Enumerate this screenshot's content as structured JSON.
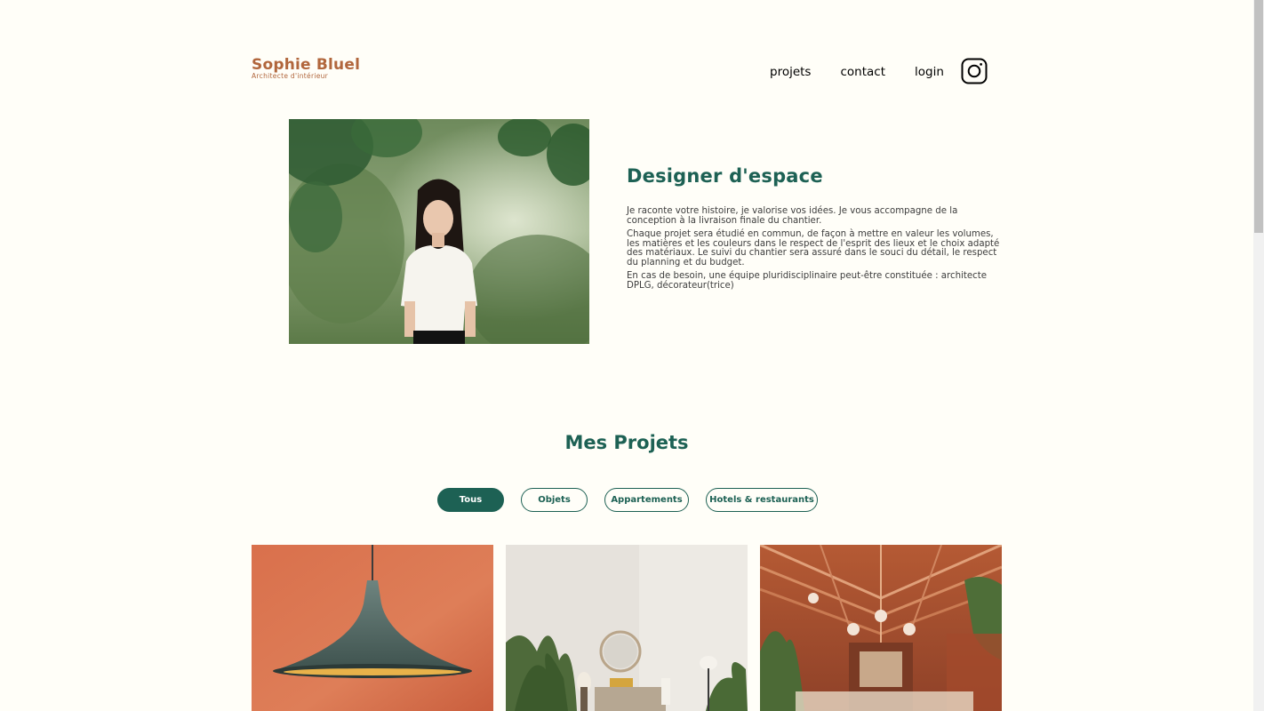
{
  "header": {
    "logo_title": "Sophie Bluel",
    "logo_subtitle": "Architecte d'intérieur",
    "nav": [
      "projets",
      "contact",
      "login"
    ],
    "instagram_icon": "instagram-icon"
  },
  "intro": {
    "title": "Designer d'espace",
    "paragraphs": [
      "Je raconte votre histoire, je valorise vos idées. Je vous accompagne de la conception à la livraison finale du chantier.",
      "Chaque projet sera étudié en commun, de façon à mettre en valeur les volumes, les matières et les couleurs dans le respect de l'esprit des lieux et le choix adapté des matériaux. Le suivi du chantier sera assuré dans le souci du détail, le respect du planning et du budget.",
      "En cas de besoin, une équipe pluridisciplinaire peut-être constituée : architecte DPLG, décorateur(trice)"
    ]
  },
  "projects": {
    "title": "Mes Projets",
    "filters": [
      "Tous",
      "Objets",
      "Appartements",
      "Hotels & restaurants"
    ],
    "active_filter": "Tous"
  },
  "colors": {
    "primary": "#1D6154",
    "brand": "#B1663C",
    "background": "#FFFEF8"
  }
}
